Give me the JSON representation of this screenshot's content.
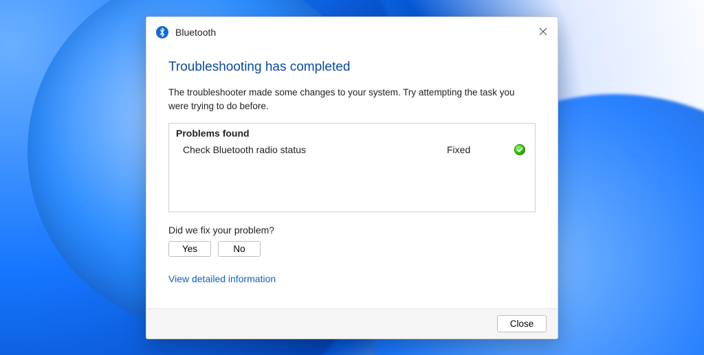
{
  "window": {
    "title": "Bluetooth"
  },
  "main": {
    "heading": "Troubleshooting has completed",
    "description": "The troubleshooter made some changes to your system. Try attempting the task you were trying to do before.",
    "panel_header": "Problems found",
    "problems": [
      {
        "label": "Check Bluetooth radio status",
        "status": "Fixed"
      }
    ],
    "feedback_question": "Did we fix your problem?",
    "yes_label": "Yes",
    "no_label": "No",
    "detail_link": "View detailed information"
  },
  "footer": {
    "close_label": "Close"
  }
}
